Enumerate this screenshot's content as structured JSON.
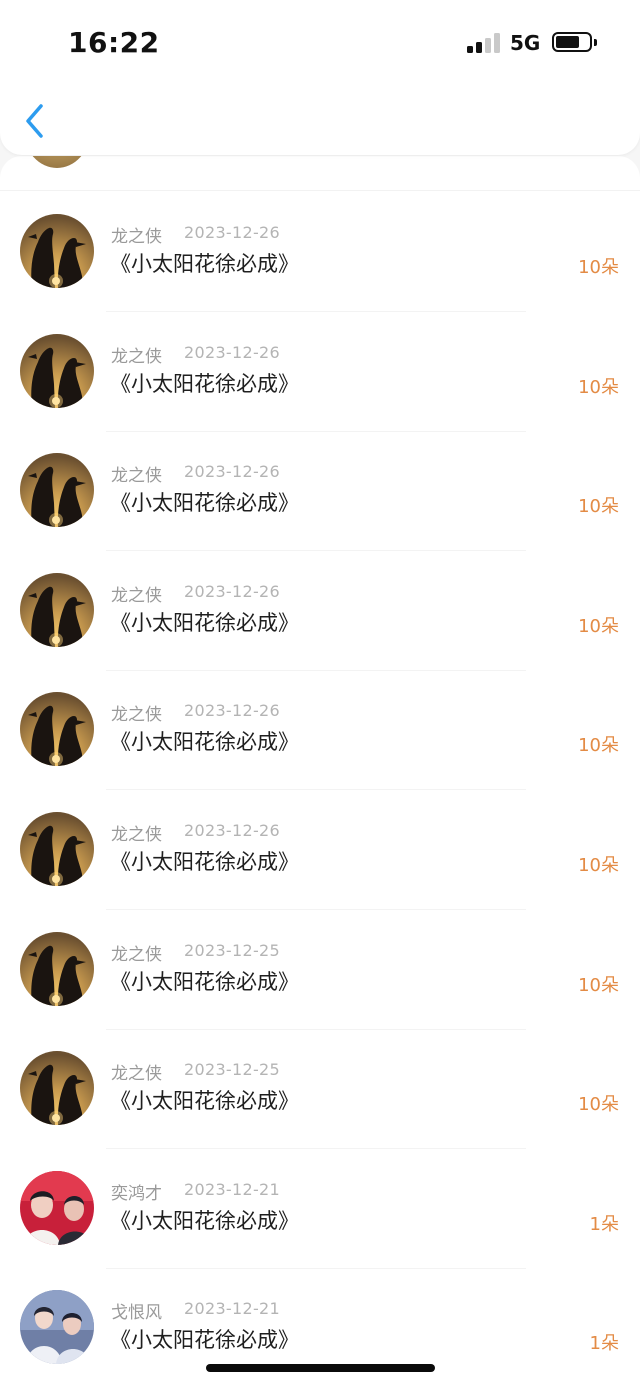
{
  "status_bar": {
    "time": "16:22",
    "network": "5G"
  },
  "nav": {
    "back_icon": "chevron-left-icon"
  },
  "colors": {
    "accent_blue": "#2d9cef",
    "count_orange": "#e38b45",
    "name_gray": "#9a9a9a",
    "date_gray": "#b4b4b4",
    "title_black": "#1f1f1f"
  },
  "records": [
    {
      "name": "龙之侠",
      "date": "2023-12-26",
      "title": "《小太阳花徐必成》",
      "count": "10朵",
      "avatar": "penguin-sunset"
    },
    {
      "name": "龙之侠",
      "date": "2023-12-26",
      "title": "《小太阳花徐必成》",
      "count": "10朵",
      "avatar": "penguin-sunset"
    },
    {
      "name": "龙之侠",
      "date": "2023-12-26",
      "title": "《小太阳花徐必成》",
      "count": "10朵",
      "avatar": "penguin-sunset"
    },
    {
      "name": "龙之侠",
      "date": "2023-12-26",
      "title": "《小太阳花徐必成》",
      "count": "10朵",
      "avatar": "penguin-sunset"
    },
    {
      "name": "龙之侠",
      "date": "2023-12-26",
      "title": "《小太阳花徐必成》",
      "count": "10朵",
      "avatar": "penguin-sunset"
    },
    {
      "name": "龙之侠",
      "date": "2023-12-26",
      "title": "《小太阳花徐必成》",
      "count": "10朵",
      "avatar": "penguin-sunset"
    },
    {
      "name": "龙之侠",
      "date": "2023-12-25",
      "title": "《小太阳花徐必成》",
      "count": "10朵",
      "avatar": "penguin-sunset"
    },
    {
      "name": "龙之侠",
      "date": "2023-12-25",
      "title": "《小太阳花徐必成》",
      "count": "10朵",
      "avatar": "penguin-sunset"
    },
    {
      "name": "奕鸿才",
      "date": "2023-12-21",
      "title": "《小太阳花徐必成》",
      "count": "1朵",
      "avatar": "red-stage-photo"
    },
    {
      "name": "戈恨风",
      "date": "2023-12-21",
      "title": "《小太阳花徐必成》",
      "count": "1朵",
      "avatar": "blue-duo-photo"
    }
  ]
}
